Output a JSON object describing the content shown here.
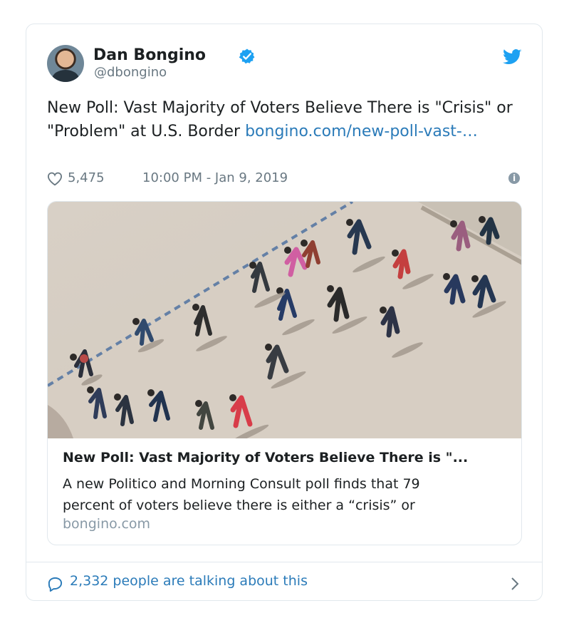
{
  "tweet": {
    "author_name": "Dan Bongino",
    "handle": "@dbongino",
    "text_prefix": "New Poll: Vast Majority of Voters Believe There is \"Crisis\" or \"Problem\" at U.S. Border ",
    "link_text": "bongino.com/new-poll-vast-…",
    "likes": "5,475",
    "timestamp": "10:00 PM - Jan 9, 2019",
    "icons": {
      "verified": "verified-icon",
      "twitter": "twitter-bird-icon",
      "like": "heart-icon",
      "info": "info-icon",
      "conversation": "comment-icon",
      "more": "chevron-right-icon"
    },
    "colors": {
      "text": "#1c2022",
      "muted": "#697882",
      "link": "#2b7bb9",
      "twitter_blue": "#1da1f2",
      "border": "#e1e8ed"
    }
  },
  "link_card": {
    "title": "New Poll: Vast Majority of Voters Believe There is \"...",
    "description": "A new Politico and Morning Consult poll finds that 79 percent of voters believe there is either a “crisis” or",
    "domain": "bongino.com"
  },
  "footer": {
    "talking": "2,332 people are talking about this"
  }
}
